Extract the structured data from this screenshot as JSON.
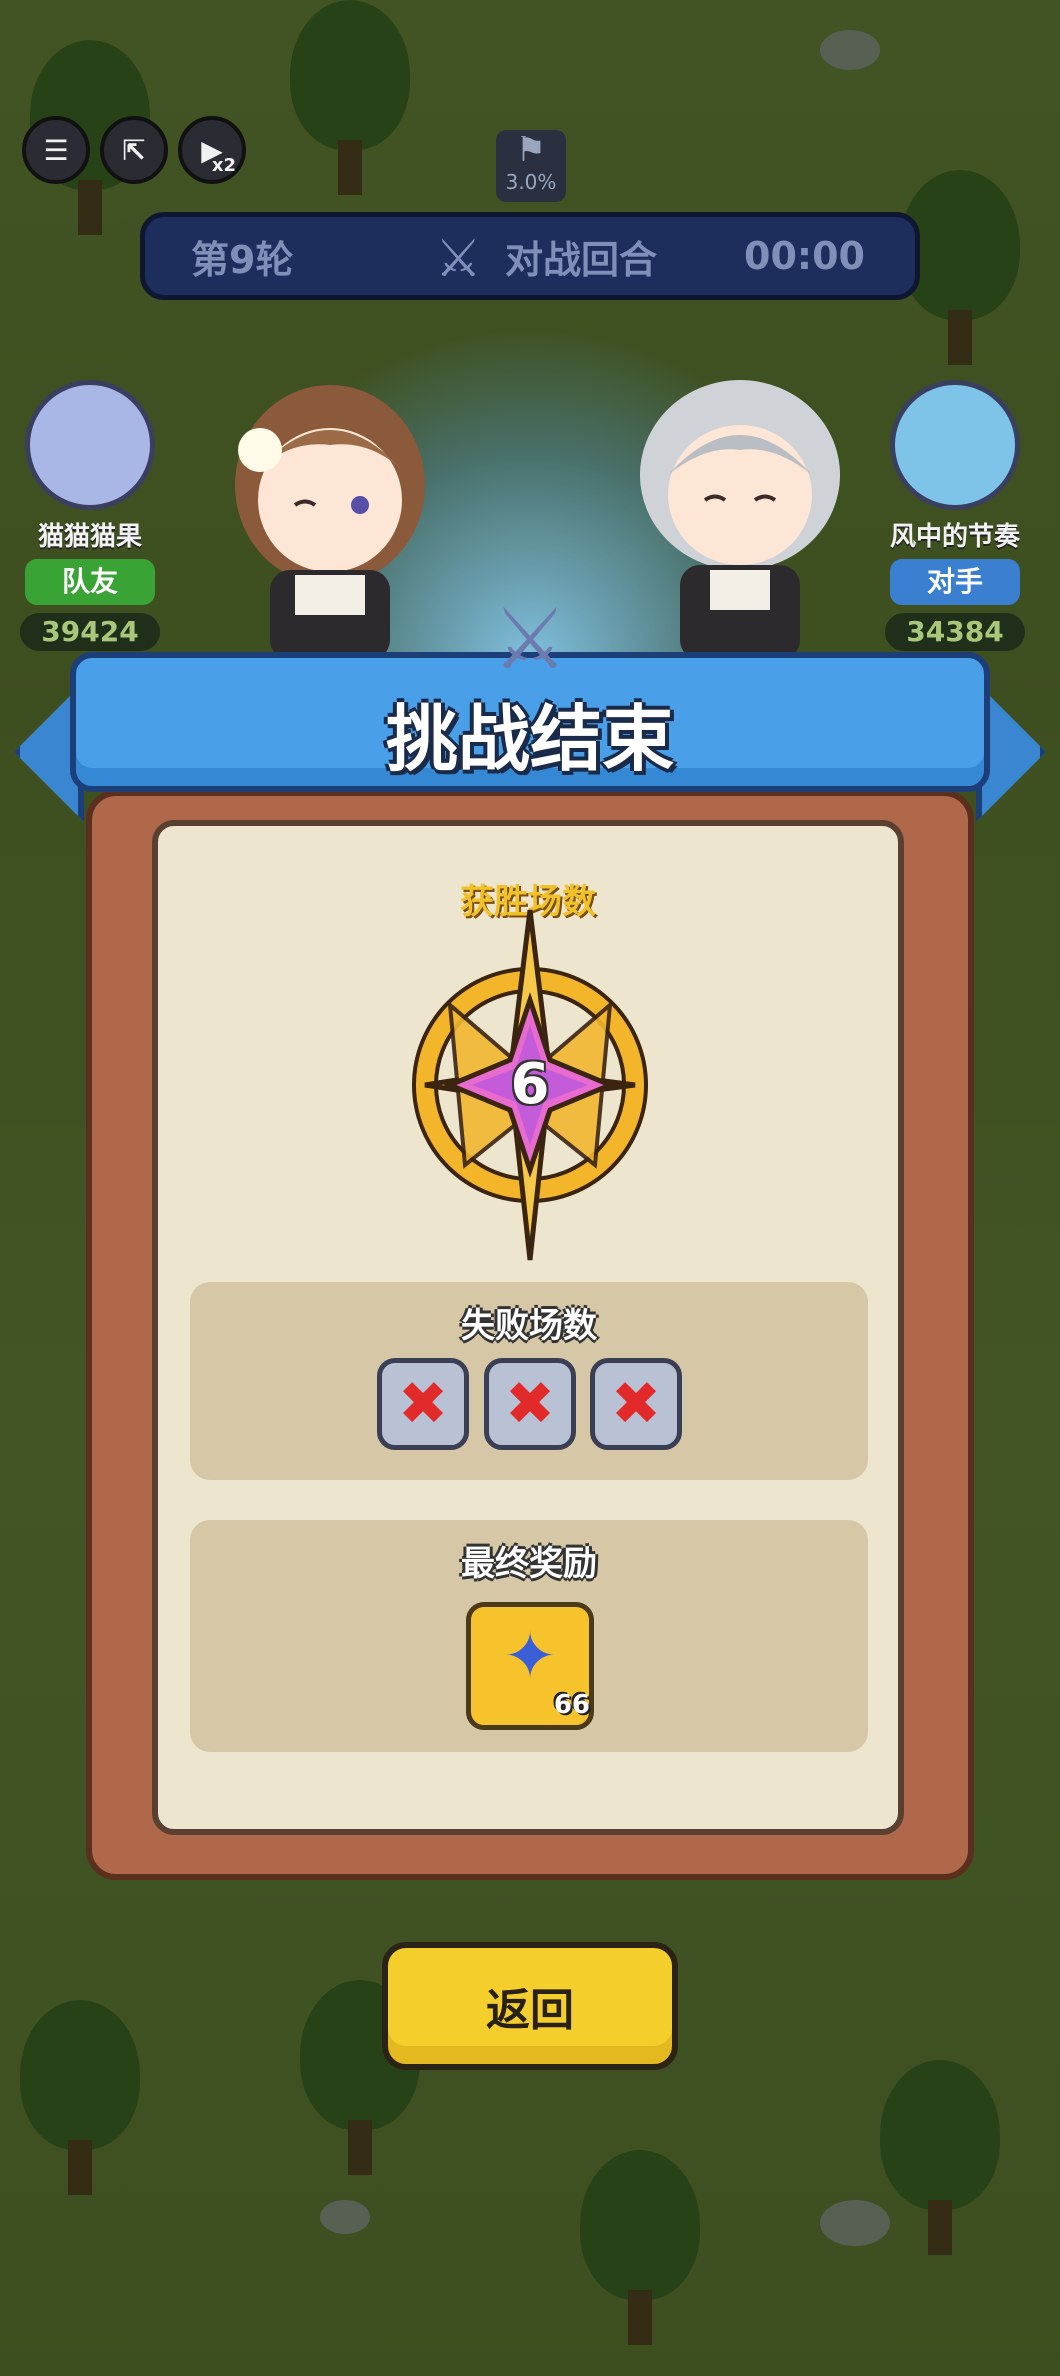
{
  "top_bar": {
    "menu_icon": "menu-icon",
    "exit_icon": "exit-icon",
    "speed_icon": "play-icon",
    "speed_label": "x2",
    "rate_value": "3.0%"
  },
  "round_bar": {
    "round_label": "第9轮",
    "phase_label": "对战回合",
    "timer": "00:00"
  },
  "players": [
    {
      "name": "猫猫猫果",
      "tag": "队友",
      "score": "39424",
      "tag_color": "#3aa335"
    },
    {
      "name": "风中的节奏",
      "tag": "对手",
      "score": "34384",
      "tag_color": "#3a7fd0"
    }
  ],
  "dialog": {
    "title": "挑战结束",
    "wins_label": "获胜场数",
    "wins_value": "6",
    "losses_label": "失败场数",
    "losses": [
      "x",
      "x",
      "x"
    ],
    "reward_label": "最终奖励",
    "reward_count": "66",
    "reward_icon": "medal-icon"
  },
  "back_button": "返回",
  "colors": {
    "banner_blue": "#4a9fe9",
    "panel_brown": "#b0684a",
    "gold": "#f1c12a",
    "loss_red": "#e32a2a",
    "button_yellow": "#f4cf2c"
  }
}
